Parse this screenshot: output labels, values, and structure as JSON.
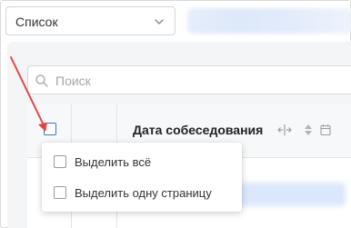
{
  "toolbar": {
    "view_select": {
      "value": "Список",
      "icon": "chevron-down-icon"
    }
  },
  "search": {
    "placeholder": "Поиск",
    "icon": "search-icon"
  },
  "table": {
    "header": {
      "column_title": "Дата собеседования",
      "icons": [
        "resize-icon",
        "sort-icon",
        "calendar-icon"
      ]
    }
  },
  "select_menu": {
    "items": [
      {
        "label": "Выделить всё",
        "checked": false
      },
      {
        "label": "Выделить одну страницу",
        "checked": false
      }
    ]
  },
  "colors": {
    "annotation_arrow": "#e04848",
    "checkbox_accent": "#3a73c9",
    "panel_bg": "#f4f5f7"
  }
}
